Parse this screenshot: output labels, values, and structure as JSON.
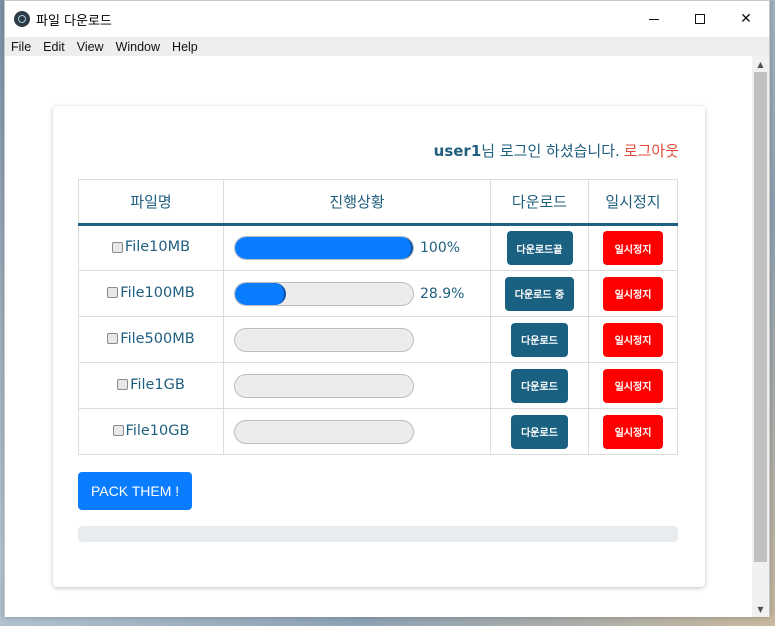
{
  "window": {
    "title": "파일 다운로드",
    "minimize_glyph": "—",
    "maximize_glyph": "☐",
    "close_glyph": "✕"
  },
  "menu": [
    "File",
    "Edit",
    "View",
    "Window",
    "Help"
  ],
  "login": {
    "username": "user1",
    "message": "님 로그인 하셨습니다.",
    "logout": "로그아웃"
  },
  "table": {
    "headers": [
      "파일명",
      "진행상황",
      "다운로드",
      "일시정지"
    ],
    "rows": [
      {
        "name": "File10MB",
        "progress": 100,
        "progress_text": "100%",
        "download_label": "다운로드끝",
        "pause_label": "일시정지"
      },
      {
        "name": "File100MB",
        "progress": 28.9,
        "progress_text": "28.9%",
        "download_label": "다운로드 중",
        "pause_label": "일시정지"
      },
      {
        "name": "File500MB",
        "progress": 0,
        "progress_text": "",
        "download_label": "다운로드",
        "pause_label": "일시정지"
      },
      {
        "name": "File1GB",
        "progress": 0,
        "progress_text": "",
        "download_label": "다운로드",
        "pause_label": "일시정지"
      },
      {
        "name": "File10GB",
        "progress": 0,
        "progress_text": "",
        "download_label": "다운로드",
        "pause_label": "일시정지"
      }
    ]
  },
  "pack_button": "PACK THEM !",
  "overall_progress": 0,
  "colors": {
    "primary": "#0a7cff",
    "teal": "#1a6080",
    "danger": "#ff0000",
    "logout": "#e04b3a"
  }
}
